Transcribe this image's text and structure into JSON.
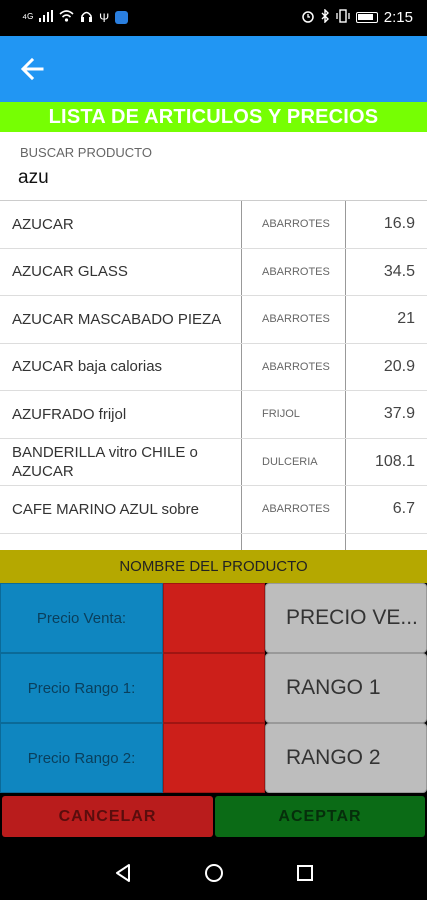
{
  "status_bar": {
    "time": "2:15",
    "left_icons": [
      "signal-4g-icon",
      "signal-bars-icon",
      "wifi-icon",
      "headset-icon",
      "usb-icon",
      "shield-icon"
    ],
    "right_icons": [
      "alarm-icon",
      "bluetooth-icon",
      "vibrate-icon",
      "battery-icon"
    ]
  },
  "app_bar": {
    "back_icon": "arrow-left-icon",
    "color": "#2196f3"
  },
  "title": "LISTA DE ARTICULOS Y PRECIOS",
  "search": {
    "label": "BUSCAR PRODUCTO",
    "value": "azu"
  },
  "products": [
    {
      "name": "AZUCAR",
      "category": "ABARROTES",
      "price": "16.9"
    },
    {
      "name": "AZUCAR GLASS",
      "category": "ABARROTES",
      "price": "34.5"
    },
    {
      "name": "AZUCAR MASCABADO PIEZA",
      "category": "ABARROTES",
      "price": "21"
    },
    {
      "name": "AZUCAR baja calorias",
      "category": "ABARROTES",
      "price": "20.9"
    },
    {
      "name": "AZUFRADO frijol",
      "category": "FRIJOL",
      "price": "37.9"
    },
    {
      "name": "BANDERILLA vitro CHILE o AZUCAR",
      "category": "DULCERIA",
      "price": "108.1"
    },
    {
      "name": "CAFE MARINO AZUL sobre",
      "category": "ABARROTES",
      "price": "6.7"
    },
    {
      "name": "",
      "category": "",
      "price": ""
    }
  ],
  "detail": {
    "header": "NOMBRE DEL PRODUCTO",
    "rows": [
      {
        "label": "Precio Venta:",
        "value": "",
        "button": "PRECIO VE..."
      },
      {
        "label": "Precio Rango 1:",
        "value": "",
        "button": "RANGO 1"
      },
      {
        "label": "Precio Rango 2:",
        "value": "",
        "button": "RANGO 2"
      }
    ]
  },
  "actions": {
    "cancel": "CANCELAR",
    "accept": "ACEPTAR"
  },
  "nav": [
    "back-triangle-icon",
    "home-circle-icon",
    "recents-square-icon"
  ]
}
